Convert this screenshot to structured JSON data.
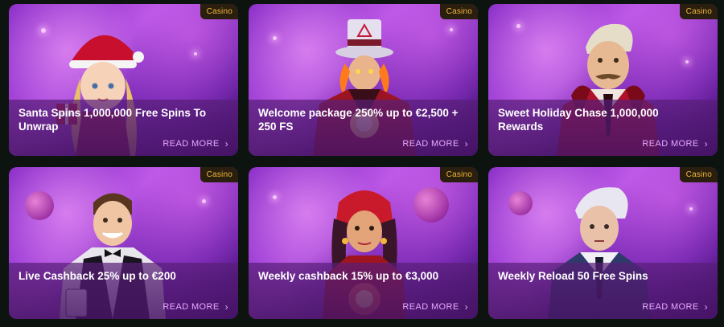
{
  "promotions": [
    {
      "badge": "Casino",
      "title": "Santa Spins 1,000,000 Free Spins To Unwrap",
      "read_more": "READ MORE",
      "icon": "chevron-right-icon",
      "character": "santa-girl"
    },
    {
      "badge": "Casino",
      "title": "Welcome package 250% up to €2,500 + 250 FS",
      "read_more": "READ MORE",
      "icon": "chevron-right-icon",
      "character": "magician"
    },
    {
      "badge": "Casino",
      "title": "Sweet Holiday Chase 1,000,000 Rewards",
      "read_more": "READ MORE",
      "icon": "chevron-right-icon",
      "character": "mustache-man"
    },
    {
      "badge": "Casino",
      "title": "Live Cashback 25% up to €200",
      "read_more": "READ MORE",
      "icon": "chevron-right-icon",
      "character": "dealer"
    },
    {
      "badge": "Casino",
      "title": "Weekly cashback 15% up to €3,000",
      "read_more": "READ MORE",
      "icon": "chevron-right-icon",
      "character": "fortune-teller"
    },
    {
      "badge": "Casino",
      "title": "Weekly Reload 50 Free Spins",
      "read_more": "READ MORE",
      "icon": "chevron-right-icon",
      "character": "young-man"
    }
  ],
  "colors": {
    "badge_text": "#f2b63a",
    "read_more": "#e9a8ff",
    "background": "#0d1410"
  }
}
